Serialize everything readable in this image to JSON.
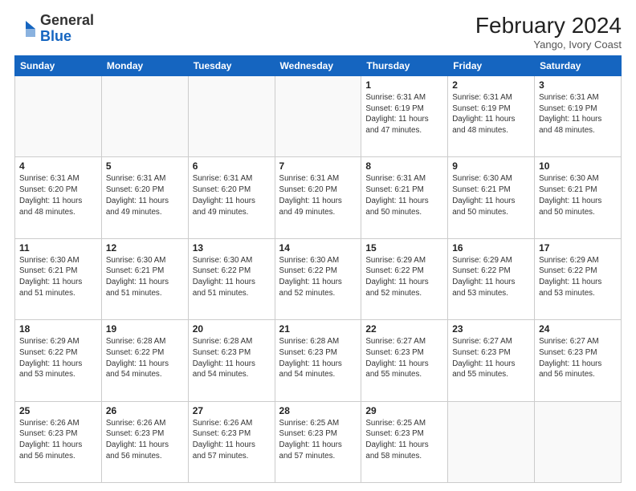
{
  "header": {
    "logo_line1": "General",
    "logo_line2": "Blue",
    "month_year": "February 2024",
    "location": "Yango, Ivory Coast"
  },
  "days_of_week": [
    "Sunday",
    "Monday",
    "Tuesday",
    "Wednesday",
    "Thursday",
    "Friday",
    "Saturday"
  ],
  "weeks": [
    [
      {
        "day": "",
        "info": ""
      },
      {
        "day": "",
        "info": ""
      },
      {
        "day": "",
        "info": ""
      },
      {
        "day": "",
        "info": ""
      },
      {
        "day": "1",
        "info": "Sunrise: 6:31 AM\nSunset: 6:19 PM\nDaylight: 11 hours\nand 47 minutes."
      },
      {
        "day": "2",
        "info": "Sunrise: 6:31 AM\nSunset: 6:19 PM\nDaylight: 11 hours\nand 48 minutes."
      },
      {
        "day": "3",
        "info": "Sunrise: 6:31 AM\nSunset: 6:19 PM\nDaylight: 11 hours\nand 48 minutes."
      }
    ],
    [
      {
        "day": "4",
        "info": "Sunrise: 6:31 AM\nSunset: 6:20 PM\nDaylight: 11 hours\nand 48 minutes."
      },
      {
        "day": "5",
        "info": "Sunrise: 6:31 AM\nSunset: 6:20 PM\nDaylight: 11 hours\nand 49 minutes."
      },
      {
        "day": "6",
        "info": "Sunrise: 6:31 AM\nSunset: 6:20 PM\nDaylight: 11 hours\nand 49 minutes."
      },
      {
        "day": "7",
        "info": "Sunrise: 6:31 AM\nSunset: 6:20 PM\nDaylight: 11 hours\nand 49 minutes."
      },
      {
        "day": "8",
        "info": "Sunrise: 6:31 AM\nSunset: 6:21 PM\nDaylight: 11 hours\nand 50 minutes."
      },
      {
        "day": "9",
        "info": "Sunrise: 6:30 AM\nSunset: 6:21 PM\nDaylight: 11 hours\nand 50 minutes."
      },
      {
        "day": "10",
        "info": "Sunrise: 6:30 AM\nSunset: 6:21 PM\nDaylight: 11 hours\nand 50 minutes."
      }
    ],
    [
      {
        "day": "11",
        "info": "Sunrise: 6:30 AM\nSunset: 6:21 PM\nDaylight: 11 hours\nand 51 minutes."
      },
      {
        "day": "12",
        "info": "Sunrise: 6:30 AM\nSunset: 6:21 PM\nDaylight: 11 hours\nand 51 minutes."
      },
      {
        "day": "13",
        "info": "Sunrise: 6:30 AM\nSunset: 6:22 PM\nDaylight: 11 hours\nand 51 minutes."
      },
      {
        "day": "14",
        "info": "Sunrise: 6:30 AM\nSunset: 6:22 PM\nDaylight: 11 hours\nand 52 minutes."
      },
      {
        "day": "15",
        "info": "Sunrise: 6:29 AM\nSunset: 6:22 PM\nDaylight: 11 hours\nand 52 minutes."
      },
      {
        "day": "16",
        "info": "Sunrise: 6:29 AM\nSunset: 6:22 PM\nDaylight: 11 hours\nand 53 minutes."
      },
      {
        "day": "17",
        "info": "Sunrise: 6:29 AM\nSunset: 6:22 PM\nDaylight: 11 hours\nand 53 minutes."
      }
    ],
    [
      {
        "day": "18",
        "info": "Sunrise: 6:29 AM\nSunset: 6:22 PM\nDaylight: 11 hours\nand 53 minutes."
      },
      {
        "day": "19",
        "info": "Sunrise: 6:28 AM\nSunset: 6:22 PM\nDaylight: 11 hours\nand 54 minutes."
      },
      {
        "day": "20",
        "info": "Sunrise: 6:28 AM\nSunset: 6:23 PM\nDaylight: 11 hours\nand 54 minutes."
      },
      {
        "day": "21",
        "info": "Sunrise: 6:28 AM\nSunset: 6:23 PM\nDaylight: 11 hours\nand 54 minutes."
      },
      {
        "day": "22",
        "info": "Sunrise: 6:27 AM\nSunset: 6:23 PM\nDaylight: 11 hours\nand 55 minutes."
      },
      {
        "day": "23",
        "info": "Sunrise: 6:27 AM\nSunset: 6:23 PM\nDaylight: 11 hours\nand 55 minutes."
      },
      {
        "day": "24",
        "info": "Sunrise: 6:27 AM\nSunset: 6:23 PM\nDaylight: 11 hours\nand 56 minutes."
      }
    ],
    [
      {
        "day": "25",
        "info": "Sunrise: 6:26 AM\nSunset: 6:23 PM\nDaylight: 11 hours\nand 56 minutes."
      },
      {
        "day": "26",
        "info": "Sunrise: 6:26 AM\nSunset: 6:23 PM\nDaylight: 11 hours\nand 56 minutes."
      },
      {
        "day": "27",
        "info": "Sunrise: 6:26 AM\nSunset: 6:23 PM\nDaylight: 11 hours\nand 57 minutes."
      },
      {
        "day": "28",
        "info": "Sunrise: 6:25 AM\nSunset: 6:23 PM\nDaylight: 11 hours\nand 57 minutes."
      },
      {
        "day": "29",
        "info": "Sunrise: 6:25 AM\nSunset: 6:23 PM\nDaylight: 11 hours\nand 58 minutes."
      },
      {
        "day": "",
        "info": ""
      },
      {
        "day": "",
        "info": ""
      }
    ]
  ]
}
